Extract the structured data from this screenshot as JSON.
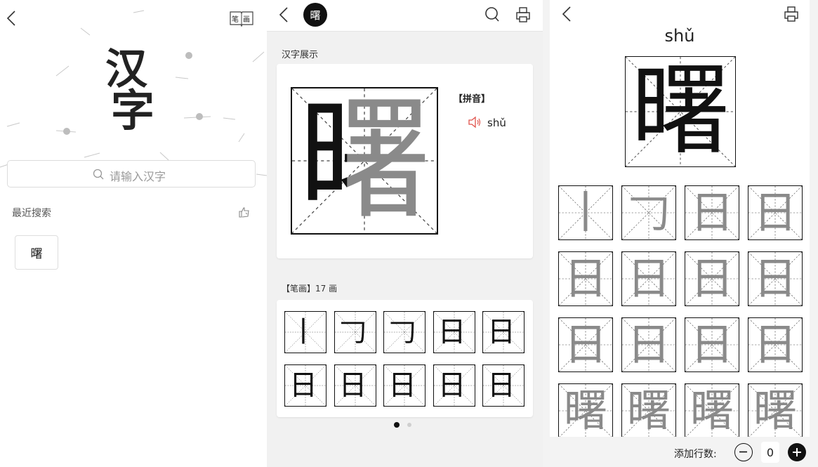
{
  "home": {
    "logo_top": "汉",
    "logo_bottom": "字",
    "bihua_top": "笔",
    "bihua_bottom": "画",
    "search_placeholder": "请输入汉字",
    "recent_label": "最近搜索",
    "recent_items": [
      "曙"
    ]
  },
  "detail": {
    "avatar_char": "曙",
    "section_display": "汉字展示",
    "character": "曙",
    "first_stroke_preview": "日",
    "pinyin_label": "【拼音】",
    "pinyin": "shǔ",
    "stroke_header": "【笔画】17 画",
    "strokes": [
      "丨",
      "𠃌",
      "𠃌",
      "日",
      "日",
      "日",
      "日",
      "日",
      "日",
      "日"
    ],
    "pager_total": 2,
    "pager_active": 0
  },
  "practice": {
    "pinyin": "shǔ",
    "character": "曙",
    "strokes": [
      "丨",
      "𠃌",
      "日",
      "日",
      "日",
      "日",
      "日",
      "日",
      "日",
      "日",
      "日",
      "日",
      "曙",
      "曙",
      "曙",
      "曙"
    ],
    "add_rows_label": "添加行数:",
    "rows_value": "0"
  },
  "colors": {
    "speaker": "#e0524a",
    "avatar": "#111111",
    "grid_dash": "#444444",
    "stroke_grey": "#8a8a8a"
  }
}
